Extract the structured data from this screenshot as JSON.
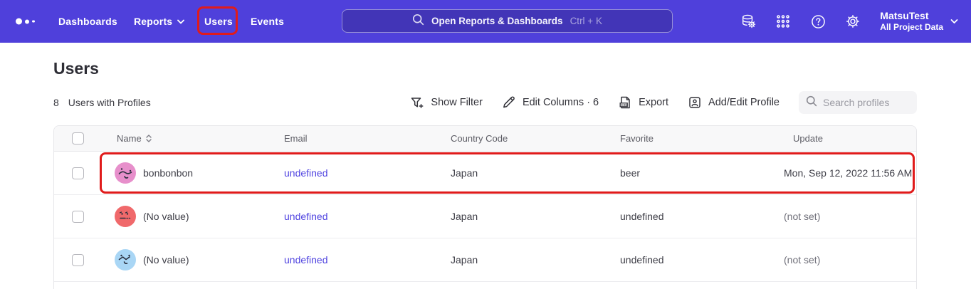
{
  "topbar": {
    "nav": {
      "dashboards": "Dashboards",
      "reports": "Reports",
      "users": "Users",
      "events": "Events"
    },
    "search": {
      "label": "Open Reports & Dashboards",
      "shortcut": "Ctrl + K"
    },
    "icons": [
      "data-management-icon",
      "apps-grid-icon",
      "help-icon",
      "settings-gear-icon"
    ],
    "project": {
      "name": "MatsuTest",
      "subtitle": "All Project Data"
    }
  },
  "page": {
    "title": "Users"
  },
  "toolbar": {
    "count": "8",
    "count_label": "Users with Profiles",
    "show_filter": "Show Filter",
    "edit_columns": "Edit Columns · 6",
    "export": "Export",
    "add_edit_profile": "Add/Edit Profile",
    "search_placeholder": "Search profiles"
  },
  "table": {
    "columns": {
      "name": "Name",
      "email": "Email",
      "country": "Country Code",
      "favorite": "Favorite",
      "update": "Update"
    },
    "rows": [
      {
        "name": "bonbonbon",
        "email": "undefined",
        "country": "Japan",
        "favorite": "beer",
        "update": "Mon, Sep 12, 2022 11:56 AM",
        "avatar_color": "#E78FCB"
      },
      {
        "name": "(No value)",
        "email": "undefined",
        "country": "Japan",
        "favorite": "undefined",
        "update": "(not set)",
        "avatar_color": "#F0696B"
      },
      {
        "name": "(No value)",
        "email": "undefined",
        "country": "Japan",
        "favorite": "undefined",
        "update": "(not set)",
        "avatar_color": "#A9D6F5"
      }
    ]
  },
  "colors": {
    "topbar_purple": "#4F40DB",
    "annotation_red": "#E01B1B",
    "link_purple": "#5044E0"
  }
}
